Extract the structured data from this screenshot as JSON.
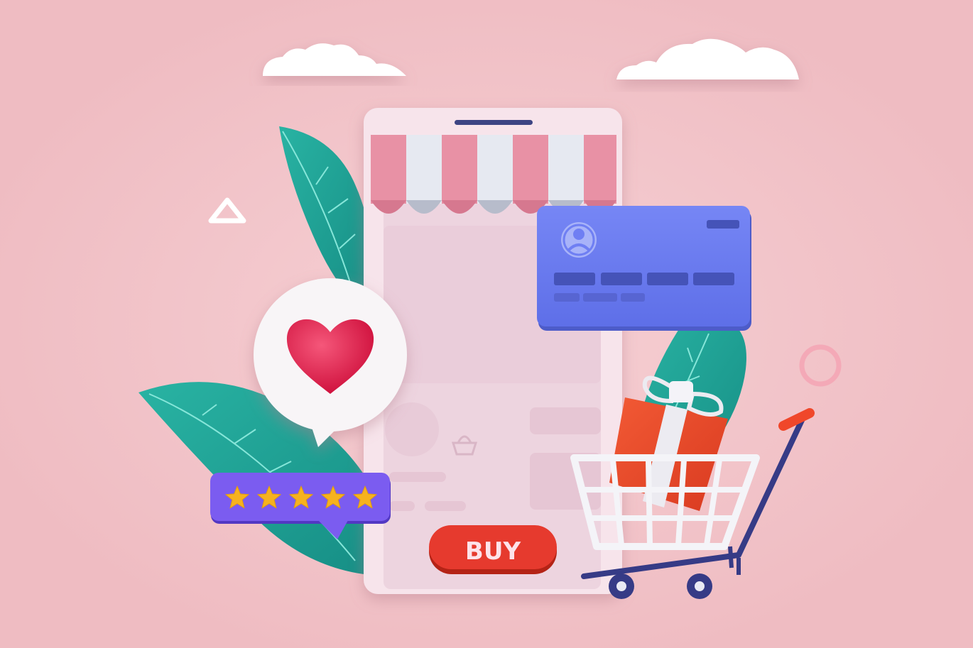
{
  "phone": {
    "buy_label": "BUY"
  },
  "rating": {
    "stars": 5,
    "max": 5
  },
  "colors": {
    "background": "#f0c2c6",
    "phone_body": "#f7e3ea",
    "phone_screen": "#ecd3df",
    "awning_pink": "#e68fa3",
    "awning_white": "#e6e9f1",
    "buy_button": "#e63a2e",
    "buy_text": "#fde3ea",
    "card": "#6f7ff3",
    "card_dark": "#4553b8",
    "leaf": "#1fa79a",
    "leaf_vein": "#7fe3d6",
    "heart": "#e01f4a",
    "rating_badge": "#7b5cf0",
    "star": "#f6b21e",
    "gift_box": "#ef4b2a",
    "gift_ribbon": "#ecebf1",
    "cart": "#f2f2f6",
    "cart_handle": "#3a3f8c",
    "cart_grip": "#f0472a",
    "ring": "#f1a7b5"
  },
  "icons": {
    "heart": "heart-icon",
    "avatar": "user-avatar-icon",
    "basket": "basket-icon",
    "star": "star-icon",
    "gift": "gift-icon",
    "cart": "shopping-cart-icon"
  }
}
